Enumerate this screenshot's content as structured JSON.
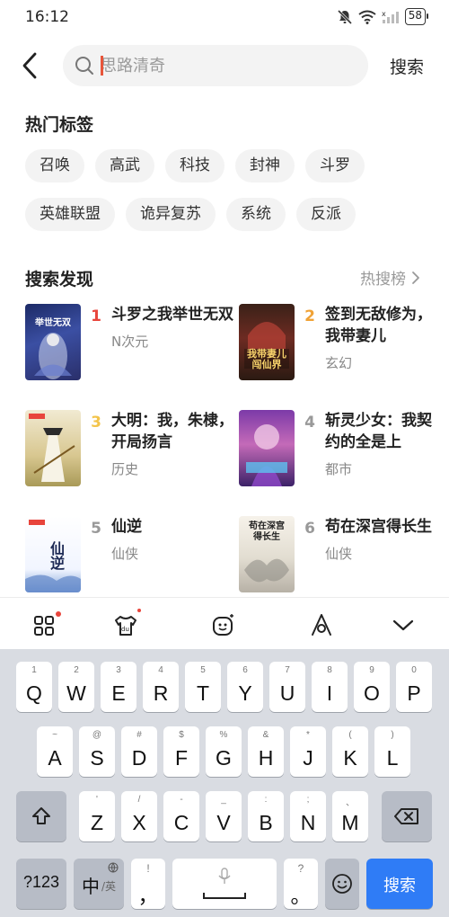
{
  "status_bar": {
    "time": "16:12",
    "battery": "58"
  },
  "search": {
    "placeholder": "思路清奇",
    "button_label": "搜索"
  },
  "hot_tags": {
    "title": "热门标签",
    "tags": [
      "召唤",
      "高武",
      "科技",
      "封神",
      "斗罗",
      "英雄联盟",
      "诡异复苏",
      "系统",
      "反派"
    ]
  },
  "discover": {
    "title": "搜索发现",
    "more_label": "热搜榜",
    "books": [
      {
        "rank": "1",
        "title": "斗罗之我举世无双",
        "genre": "N次元",
        "cover_text": "举世无双"
      },
      {
        "rank": "2",
        "title": "签到无敌修为，我带妻儿",
        "genre": "玄幻",
        "cover_text": "我带妻儿闯仙界"
      },
      {
        "rank": "3",
        "title": "大明：我，朱棣，开局扬言",
        "genre": "历史",
        "cover_text": ""
      },
      {
        "rank": "4",
        "title": "斩灵少女：我契约的全是上",
        "genre": "都市",
        "cover_text": ""
      },
      {
        "rank": "5",
        "title": "仙逆",
        "genre": "仙侠",
        "cover_text": "仙逆"
      },
      {
        "rank": "6",
        "title": "苟在深宫得长生",
        "genre": "仙侠",
        "cover_text": "苟在深宫得长生"
      }
    ]
  },
  "keyboard": {
    "row1": [
      {
        "main": "Q",
        "sub": "1"
      },
      {
        "main": "W",
        "sub": "2"
      },
      {
        "main": "E",
        "sub": "3"
      },
      {
        "main": "R",
        "sub": "4"
      },
      {
        "main": "T",
        "sub": "5"
      },
      {
        "main": "Y",
        "sub": "6"
      },
      {
        "main": "U",
        "sub": "7"
      },
      {
        "main": "I",
        "sub": "8"
      },
      {
        "main": "O",
        "sub": "9"
      },
      {
        "main": "P",
        "sub": "0"
      }
    ],
    "row2": [
      {
        "main": "A",
        "sub": "~"
      },
      {
        "main": "S",
        "sub": "@"
      },
      {
        "main": "D",
        "sub": "#"
      },
      {
        "main": "F",
        "sub": "$"
      },
      {
        "main": "G",
        "sub": "%"
      },
      {
        "main": "H",
        "sub": "&"
      },
      {
        "main": "J",
        "sub": "*"
      },
      {
        "main": "K",
        "sub": "("
      },
      {
        "main": "L",
        "sub": ")"
      }
    ],
    "row3": [
      {
        "main": "Z",
        "sub": "'"
      },
      {
        "main": "X",
        "sub": "/"
      },
      {
        "main": "C",
        "sub": "-"
      },
      {
        "main": "V",
        "sub": "_"
      },
      {
        "main": "B",
        "sub": ":"
      },
      {
        "main": "N",
        "sub": ";"
      },
      {
        "main": "M",
        "sub": "、"
      }
    ],
    "numbers_label": "?123",
    "lang_label": "中",
    "lang_alt_label": "/英",
    "comma_main": "，",
    "comma_sub": "!",
    "period_main": "。",
    "period_sub": "?",
    "enter_label": "搜索"
  },
  "icons": {
    "back": "chevron-left-icon",
    "search": "search-icon",
    "mute": "bell-off-icon",
    "wifi": "wifi-icon",
    "signal": "signal-icon"
  },
  "colors": {
    "rank1": "#e8453c",
    "rank2": "#f0a236",
    "rank3": "#f3c44b",
    "caret": "#e8553a",
    "enter_key": "#2f7cf6"
  }
}
